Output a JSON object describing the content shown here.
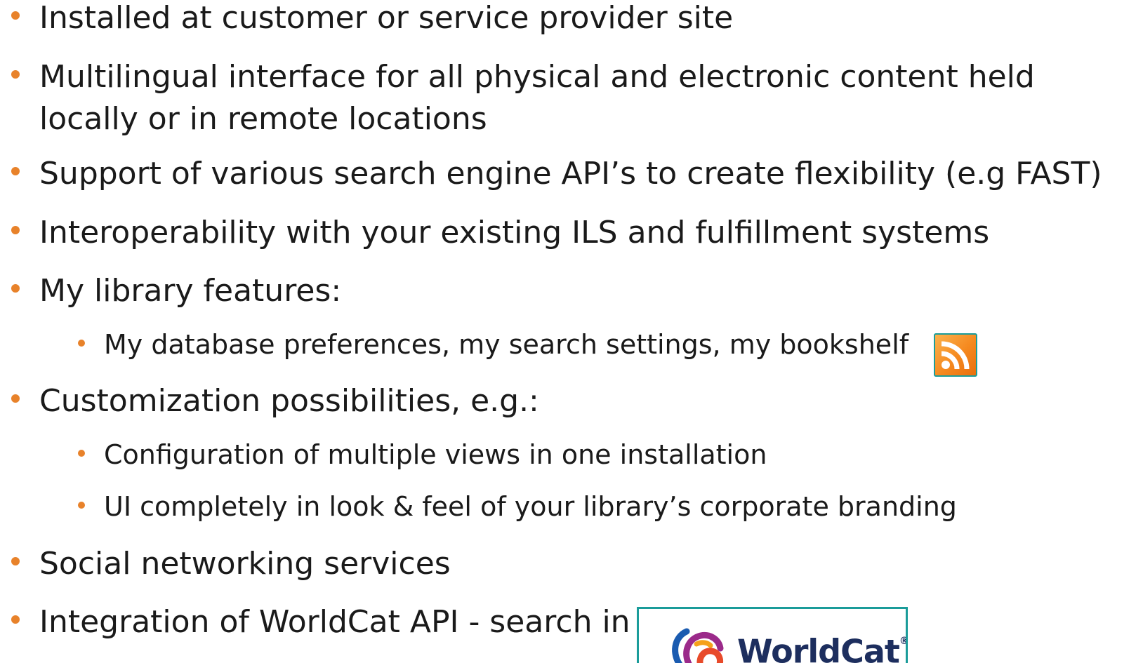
{
  "bullets": {
    "b1": "Installed at customer or service provider site",
    "b2": "Multilingual interface for all physical and electronic content held locally or in remote locations",
    "b3": "Support of various search engine API’s to create flexibility (e.g FAST)",
    "b4": "Interoperability with your existing ILS and fulfillment systems",
    "b5": "My library features:",
    "b5_1": "My database preferences, my search settings, my bookshelf",
    "b6": "Customization possibilities, e.g.:",
    "b6_1": "Configuration of multiple views in one installation",
    "b6_2": "UI completely in look & feel of your library’s corporate branding",
    "b7": "Social networking services",
    "b8": "Integration of WorldCat API - search in"
  },
  "logos": {
    "worldcat_text": "WorldCat",
    "worldcat_reg": "®"
  },
  "icons": {
    "bullet": "orange-dot",
    "feed": "rss-icon",
    "worldcat": "worldcat-logo"
  },
  "colors": {
    "bullet": "#e8822a",
    "text": "#1a1a1a",
    "frame": "#1a9c9a",
    "rss": "#f5891f",
    "worldcat_text": "#1d2e5e"
  }
}
